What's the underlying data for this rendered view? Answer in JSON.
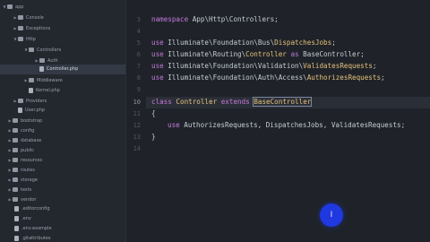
{
  "sidebar": {
    "items": [
      {
        "label": "app",
        "type": "folder",
        "open": true
      },
      {
        "label": "Console",
        "type": "folder",
        "open": false
      },
      {
        "label": "Exceptions",
        "type": "folder",
        "open": false
      },
      {
        "label": "Http",
        "type": "folder",
        "open": true
      },
      {
        "label": "Controllers",
        "type": "folder",
        "open": true
      },
      {
        "label": "Auth",
        "type": "folder",
        "open": false
      },
      {
        "label": "Controller.php",
        "type": "file",
        "selected": true
      },
      {
        "label": "Middleware",
        "type": "folder",
        "open": false
      },
      {
        "label": "Kernel.php",
        "type": "file"
      },
      {
        "label": "Providers",
        "type": "folder",
        "open": false
      },
      {
        "label": "User.php",
        "type": "file"
      },
      {
        "label": "bootstrap",
        "type": "folder",
        "open": false
      },
      {
        "label": "config",
        "type": "folder",
        "open": false
      },
      {
        "label": "database",
        "type": "folder",
        "open": false
      },
      {
        "label": "public",
        "type": "folder",
        "open": false
      },
      {
        "label": "resources",
        "type": "folder",
        "open": false
      },
      {
        "label": "routes",
        "type": "folder",
        "open": false
      },
      {
        "label": "storage",
        "type": "folder",
        "open": false
      },
      {
        "label": "tests",
        "type": "folder",
        "open": false
      },
      {
        "label": "vendor",
        "type": "folder",
        "open": false
      },
      {
        "label": ".editorconfig",
        "type": "file"
      },
      {
        "label": ".env",
        "type": "file"
      },
      {
        "label": ".env.example",
        "type": "file"
      },
      {
        "label": ".gitattributes",
        "type": "file"
      }
    ]
  },
  "editor": {
    "line_numbers": [
      "3",
      "4",
      "5",
      "6",
      "7",
      "8",
      "9",
      "10",
      "11",
      "12",
      "13",
      "14"
    ],
    "active_line": "10",
    "code": {
      "l3_kw": "namespace",
      "l3_ns": " App\\Http\\Controllers;",
      "l5_kw": "use",
      "l5_ns": " Illuminate\\Foundation\\Bus\\",
      "l5_cls": "DispatchesJobs",
      "l5_end": ";",
      "l6_kw": "use",
      "l6_ns": " Illuminate\\Routing\\",
      "l6_cls": "Controller",
      "l6_as": " as ",
      "l6_alias": "BaseController",
      "l6_end": ";",
      "l7_kw": "use",
      "l7_ns": " Illuminate\\Foundation\\Validation\\",
      "l7_cls": "ValidatesRequests",
      "l7_end": ";",
      "l8_kw": "use",
      "l8_ns": " Illuminate\\Foundation\\Auth\\Access\\",
      "l8_cls": "AuthorizesRequests",
      "l8_end": ";",
      "l10_kw1": "class",
      "l10_cls": " Controller ",
      "l10_kw2": "extends",
      "l10_sp": " ",
      "l10_base": "BaseController",
      "l11": "{",
      "l12_kw": "use",
      "l12_rest": " AuthorizesRequests, DispatchesJobs, ValidatesRequests;",
      "l13": "}"
    }
  },
  "fab": {
    "label": "I"
  }
}
